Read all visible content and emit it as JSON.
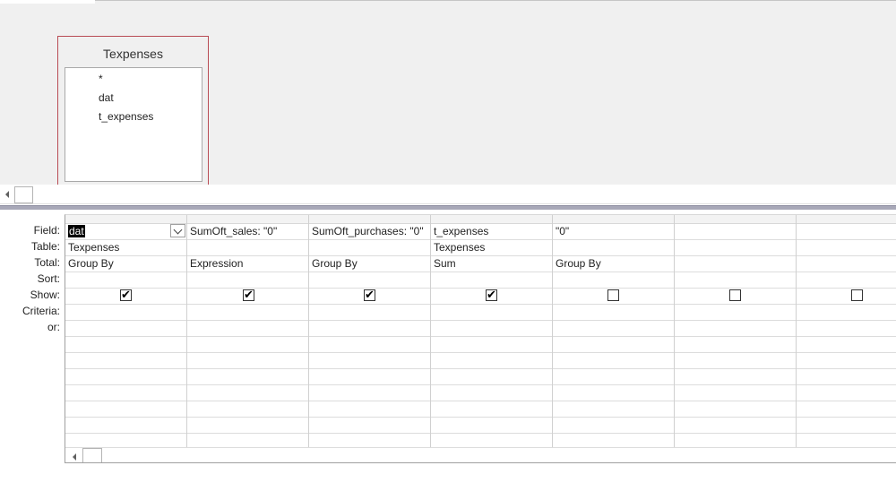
{
  "table": {
    "name": "Texpenses",
    "fields": [
      "*",
      "dat",
      "t_expenses"
    ]
  },
  "grid": {
    "row_labels": [
      "Field:",
      "Table:",
      "Total:",
      "Sort:",
      "Show:",
      "Criteria:",
      "or:"
    ],
    "columns": [
      {
        "field": "dat",
        "table": "Texpenses",
        "total": "Group By",
        "sort": "",
        "show": true,
        "criteria": "",
        "or": ""
      },
      {
        "field": "SumOft_sales: \"0\"",
        "table": "",
        "total": "Expression",
        "sort": "",
        "show": true,
        "criteria": "",
        "or": ""
      },
      {
        "field": "SumOft_purchases: \"0\"",
        "table": "",
        "total": "Group By",
        "sort": "",
        "show": true,
        "criteria": "",
        "or": ""
      },
      {
        "field": "t_expenses",
        "table": "Texpenses",
        "total": "Sum",
        "sort": "",
        "show": true,
        "criteria": "",
        "or": ""
      },
      {
        "field": "\"0\"",
        "table": "",
        "total": "Group By",
        "sort": "",
        "show": false,
        "criteria": "",
        "or": ""
      },
      {
        "field": "",
        "table": "",
        "total": "",
        "sort": "",
        "show": false,
        "criteria": "",
        "or": ""
      },
      {
        "field": "",
        "table": "",
        "total": "",
        "sort": "",
        "show": false,
        "criteria": "",
        "or": ""
      }
    ]
  },
  "icons": {
    "dropdown": "chevron-down-icon",
    "scroll_left": "arrow-left-icon",
    "checkmark": "✔"
  }
}
